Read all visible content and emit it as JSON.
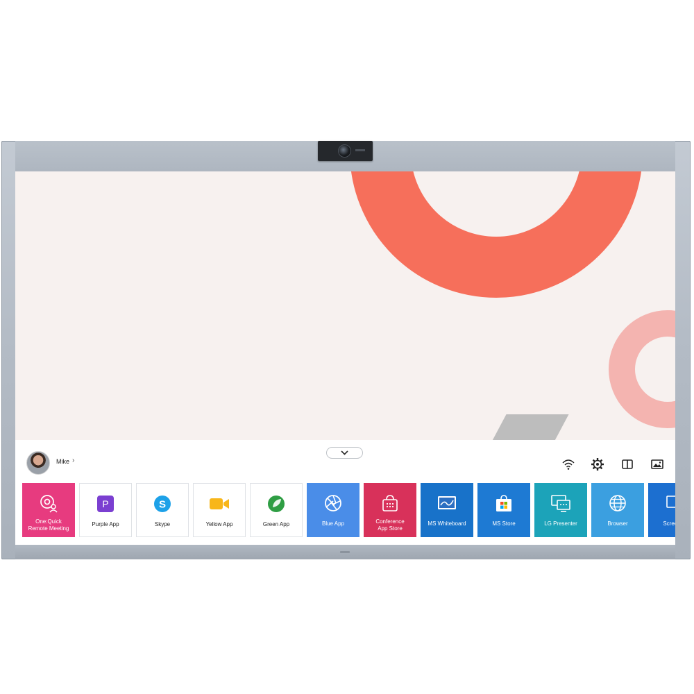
{
  "user": {
    "name": "Mike",
    "chevron": "›"
  },
  "colors": {
    "frame": "#b3bbc5",
    "screen_bg": "#f7f1ef",
    "ring_accent": "#f66f5b",
    "ring_pale": "#f4b4b0"
  },
  "controls": {
    "collapse_icon": "chevron-down-icon",
    "tray": [
      "wifi-icon",
      "settings-icon",
      "split-view-icon",
      "picture-icon"
    ]
  },
  "apps": [
    {
      "label": "One:Quick Remote Meeting",
      "line1": "One:Quick",
      "line2": "Remote Meeting",
      "icon": "remote-meeting-icon",
      "bg": "#e73b7f",
      "theme": "dark"
    },
    {
      "label": "Purple App",
      "icon": "purple-app-icon",
      "bg": "#ffffff",
      "theme": "light"
    },
    {
      "label": "Skype",
      "icon": "skype-icon",
      "bg": "#ffffff",
      "theme": "light"
    },
    {
      "label": "Yellow App",
      "icon": "yellow-app-icon",
      "bg": "#ffffff",
      "theme": "light"
    },
    {
      "label": "Green App",
      "icon": "green-app-icon",
      "bg": "#ffffff",
      "theme": "light"
    },
    {
      "label": "Blue App",
      "icon": "blue-app-icon",
      "bg": "#4a8de8",
      "theme": "dark"
    },
    {
      "label": "Conference App Store",
      "line1": "Conference",
      "line2": "App Store",
      "icon": "app-store-icon",
      "bg": "#d8315a",
      "theme": "dark"
    },
    {
      "label": "MS Whiteboard",
      "icon": "whiteboard-icon",
      "bg": "#1872c9",
      "theme": "dark"
    },
    {
      "label": "MS Store",
      "icon": "ms-store-icon",
      "bg": "#1e7ad3",
      "theme": "dark"
    },
    {
      "label": "LG Presenter",
      "icon": "presenter-icon",
      "bg": "#1ca3b9",
      "theme": "dark"
    },
    {
      "label": "Browser",
      "icon": "browser-icon",
      "bg": "#3b9fe0",
      "theme": "dark"
    },
    {
      "label": "Screen C",
      "icon": "screen-share-icon",
      "bg": "#1c6fd0",
      "theme": "dark"
    }
  ]
}
